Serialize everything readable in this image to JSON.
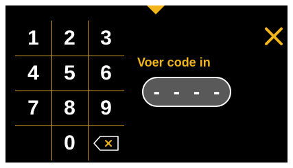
{
  "colors": {
    "background": "#000000",
    "accent": "#f2b51c",
    "field_fill": "#595959",
    "text": "#ffffff"
  },
  "keypad": {
    "keys": [
      "1",
      "2",
      "3",
      "4",
      "5",
      "6",
      "7",
      "8",
      "9",
      "0"
    ],
    "backspace_icon": "backspace-icon"
  },
  "code_entry": {
    "label": "Voer code in",
    "placeholder": "- - - -"
  },
  "icons": {
    "close": "close-icon",
    "top_indicator": "caret-down-icon",
    "bottom_indicator": "handle-icon"
  }
}
